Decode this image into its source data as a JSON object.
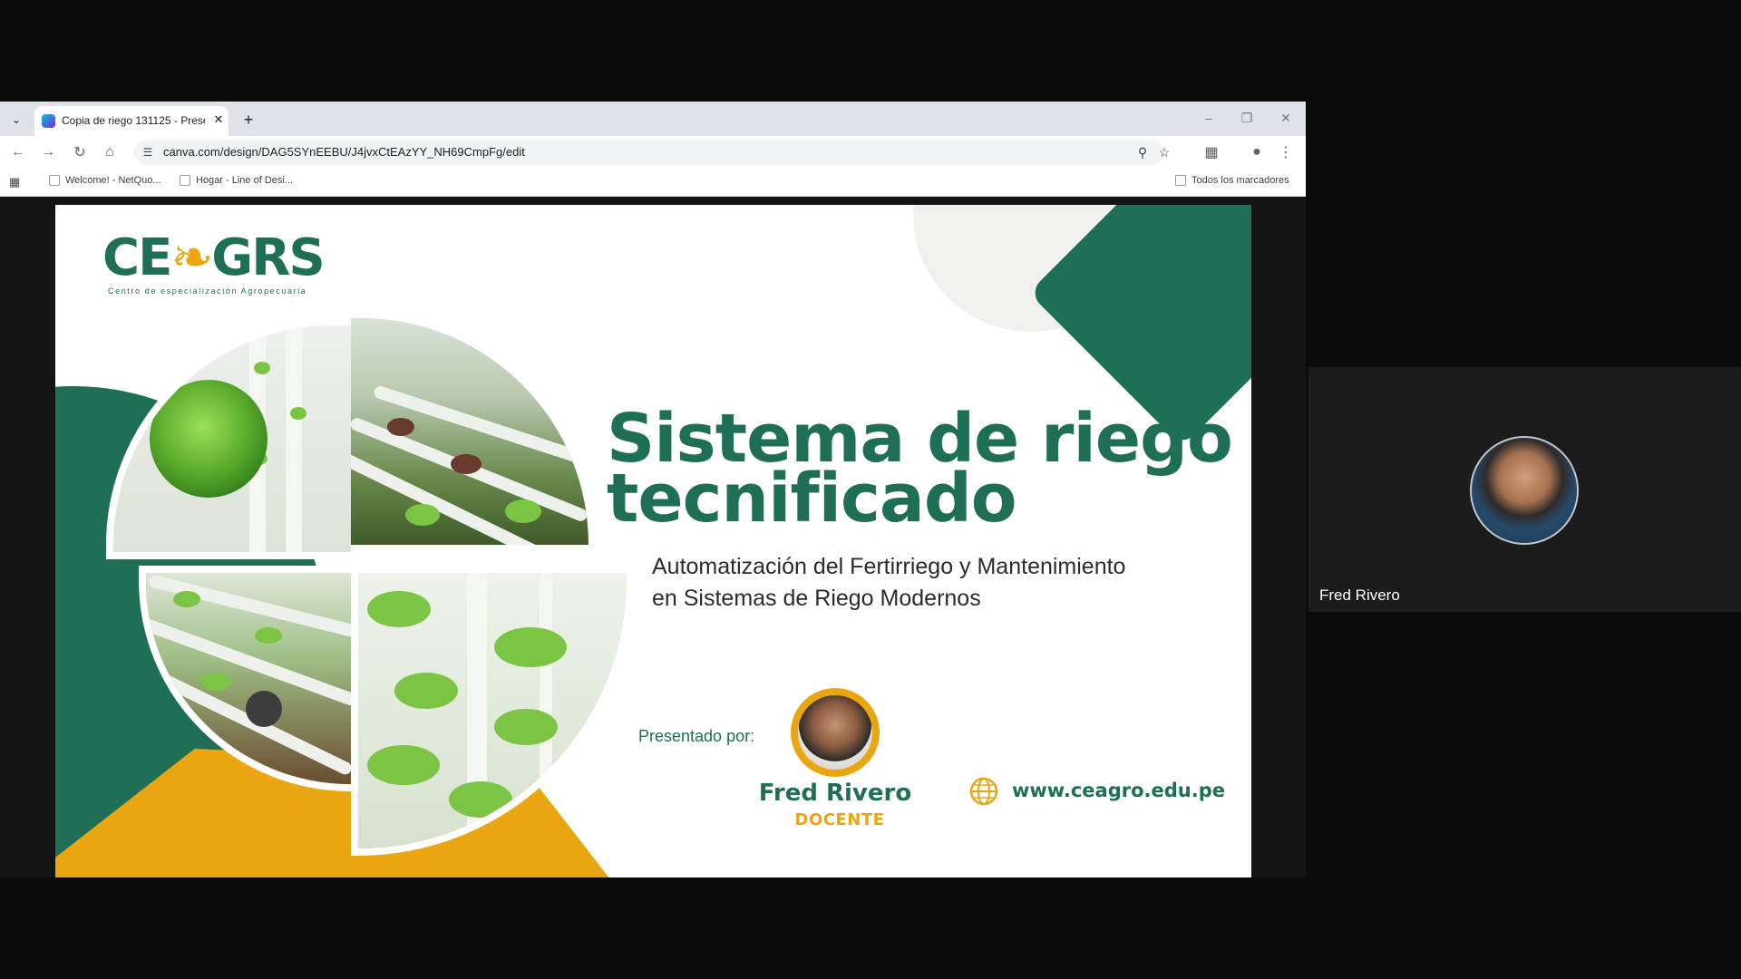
{
  "browser": {
    "tab_title": "Copia de riego 131125 - Presen",
    "url": "canva.com/design/DAG5SYnEEBU/J4jvxCtEAzYY_NH69CmpFg/edit",
    "bookmarks": [
      {
        "label": "Welcome! - NetQuo..."
      },
      {
        "label": "Hogar - Line of Desi..."
      }
    ],
    "all_bookmarks_label": "Todos los marcadores"
  },
  "slide": {
    "logo_text_1": "CE",
    "logo_text_2": "GR",
    "logo_text_3": "S",
    "logo_subtitle": "Centro de especialización Agropecuaria",
    "title_line1": "Sistema de riego",
    "title_line2": "tecnificado",
    "subtitle_line1": "Automatización del Fertirriego y Mantenimiento",
    "subtitle_line2": "en Sistemas de Riego Modernos",
    "presented_by": "Presentado por:",
    "presenter_name": "Fred Rivero",
    "presenter_role": "DOCENTE",
    "website": "www.ceagro.edu.pe"
  },
  "participant": {
    "name": "Fred Rivero"
  },
  "colors": {
    "brand_green": "#1f6f57",
    "brand_yellow": "#e9a611"
  }
}
